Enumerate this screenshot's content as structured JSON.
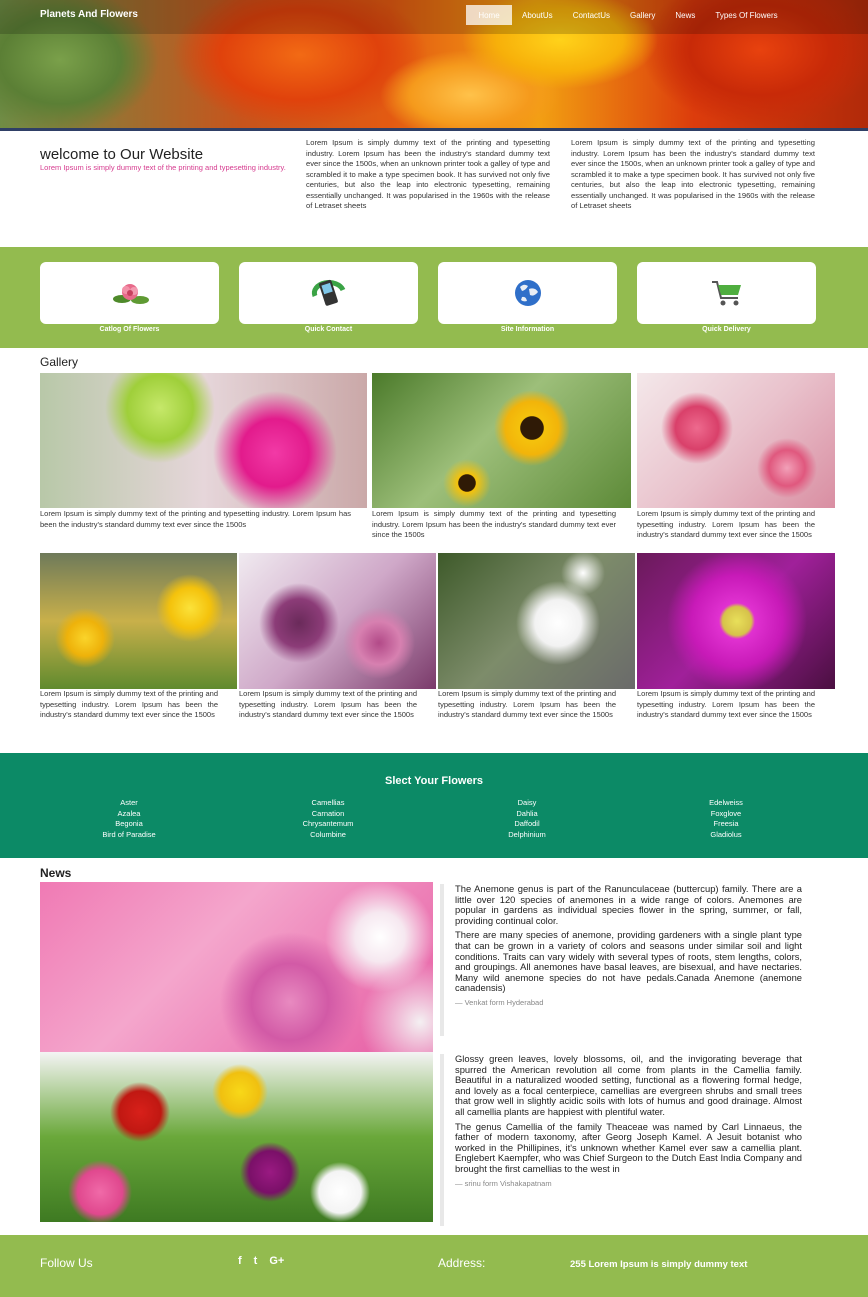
{
  "header": {
    "brand": "Planets And Flowers",
    "nav": [
      "Home",
      "AboutUs",
      "ContactUs",
      "Gallery",
      "News",
      "Types Of Flowers"
    ]
  },
  "welcome": {
    "title": "welcome to Our Website",
    "subtitle": "Lorem Ipsum is simply dummy text of the printing and typesetting industry.",
    "para1": "Lorem Ipsum is simply dummy text of the printing and typesetting industry. Lorem Ipsum has been the industry's standard dummy text ever since the 1500s, when an unknown printer took a galley of type and scrambled it to make a type specimen book. It has survived not only five centuries, but also the leap into electronic typesetting, remaining essentially unchanged. It was popularised in the 1960s with the release of Letraset sheets",
    "para2": "Lorem Ipsum is simply dummy text of the printing and typesetting industry. Lorem Ipsum has been the industry's standard dummy text ever since the 1500s, when an unknown printer took a galley of type and scrambled it to make a type specimen book. It has survived not only five centuries, but also the leap into electronic typesetting, remaining essentially unchanged. It was popularised in the 1960s with the release of Letraset sheets"
  },
  "features": [
    {
      "label": "Catlog Of Flowers",
      "icon": "flower-icon"
    },
    {
      "label": "Quick Contact",
      "icon": "phone-icon"
    },
    {
      "label": "Site Information",
      "icon": "globe-icon"
    },
    {
      "label": "Quick Delivery",
      "icon": "cart-icon"
    }
  ],
  "gallery": {
    "title": "Gallery",
    "captions": [
      "Lorem Ipsum is simply dummy text of the printing and typesetting industry. Lorem Ipsum has been the industry's standard dummy text ever since the 1500s",
      "Lorem Ipsum is simply dummy text of the printing and typesetting industry. Lorem Ipsum has been the industry's standard dummy text ever since the 1500s",
      "Lorem Ipsum is simply dummy text of the printing and typesetting industry. Lorem Ipsum has been the industry's standard dummy text ever since the 1500s",
      "Lorem Ipsum is simply dummy text of the printing and typesetting industry. Lorem Ipsum has been the industry's standard dummy text ever since the 1500s",
      "Lorem Ipsum is simply dummy text of the printing and typesetting industry. Lorem Ipsum has been the industry's standard dummy text ever since the 1500s",
      "Lorem Ipsum is simply dummy text of the printing and typesetting industry. Lorem Ipsum has been the industry's standard dummy text ever since the 1500s",
      "Lorem Ipsum is simply dummy text of the printing and typesetting industry. Lorem Ipsum has been the industry's standard dummy text ever since the 1500s"
    ]
  },
  "select_flowers": {
    "title": "Slect Your Flowers",
    "columns": [
      [
        "Aster",
        "Azalea",
        "Begonia",
        "Bird of Paradise"
      ],
      [
        "Camellias",
        "Carnation",
        "Chrysantemum",
        "Columbine"
      ],
      [
        "Daisy",
        "Dahlia",
        "Daffodil",
        "Delphinium"
      ],
      [
        "Edelweiss",
        "Foxglove",
        "Freesia",
        "Gladiolus"
      ]
    ]
  },
  "news": {
    "title": "News",
    "items": [
      {
        "paragraphs": [
          "The Anemone genus is part of the Ranunculaceae (buttercup) family. There are a little over 120 species of anemones in a wide range of colors. Anemones are popular in gardens as individual species flower in the spring, summer, or fall, providing continual color.",
          "There are many species of anemone, providing gardeners with a single plant type that can be grown in a variety of colors and seasons under similar soil and light conditions. Traits can vary widely with several types of roots, stem lengths, colors, and groupings. All anemones have basal leaves, are bisexual, and have nectaries. Many wild anemone species do not have pedals.Canada Anemone (anemone canadensis)"
        ],
        "cite": "— Venkat form Hyderabad"
      },
      {
        "paragraphs": [
          "Glossy green leaves, lovely blossoms, oil, and the invigorating beverage that spurred the American revolution all come from plants in the Camellia family. Beautiful in a naturalized wooded setting, functional as a flowering formal hedge, and lovely as a focal centerpiece, camellias are evergreen shrubs and small trees that grow well in slightly acidic soils with lots of humus and good drainage. Almost all camellia plants are happiest with plentiful water.",
          "The genus Camellia of the family Theaceae was named by Carl Linnaeus, the father of modern taxonomy, after Georg Joseph Kamel. A Jesuit botanist who worked in the Phillipines, it's unknown whether Kamel ever saw a camellia plant. Englebert Kaempfer, who was Chief Surgeon to the Dutch East India Company and brought the first camellias to the west in"
        ],
        "cite": "— srinu form Vishakapatnam"
      }
    ]
  },
  "footer": {
    "follow": "Follow Us",
    "social": [
      "facebook-icon",
      "twitter-icon",
      "google-plus-icon"
    ],
    "address_label": "Address:",
    "address": "255 Lorem Ipsum is simply dummy text"
  }
}
